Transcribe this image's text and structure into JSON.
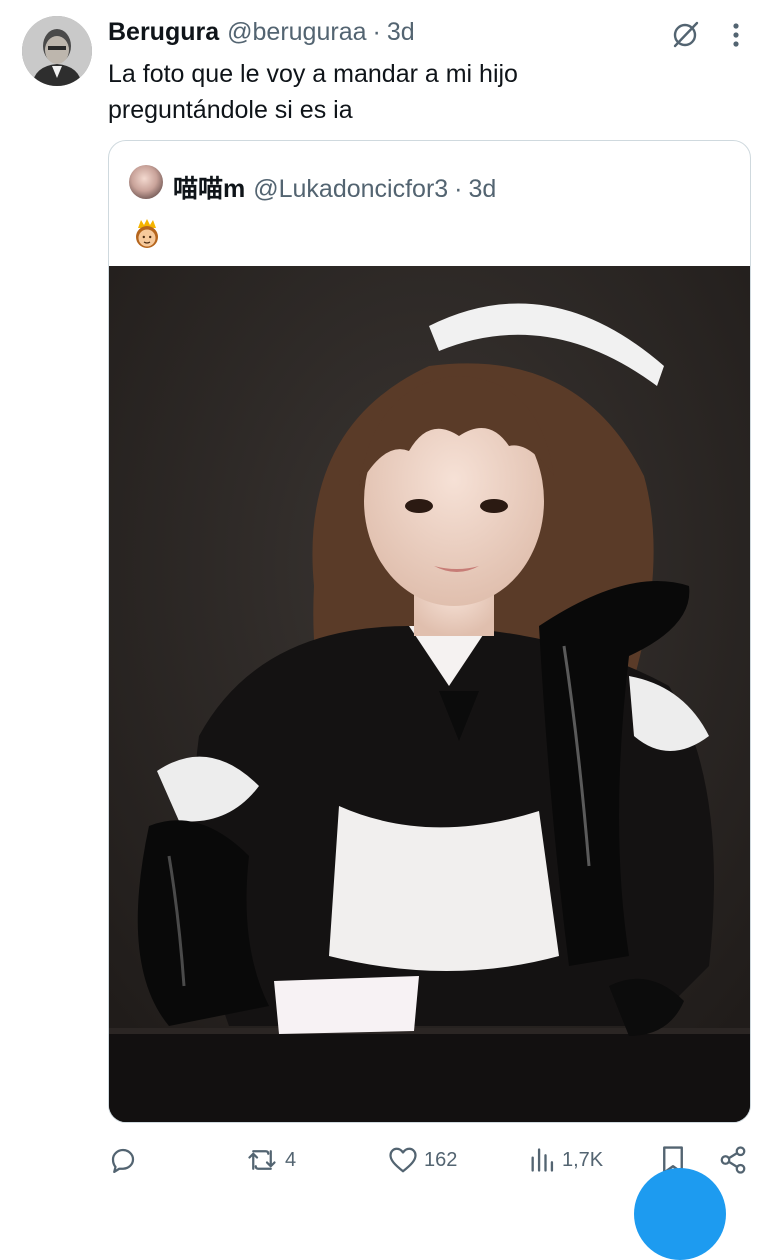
{
  "tweet": {
    "author_name": "Berugura",
    "author_handle": "@beruguraa",
    "separator": "·",
    "time": "3d",
    "text_line1": "La foto que le voy a mandar a mi hijo",
    "text_line2": "preguntándole si es ia",
    "icons": {
      "grok": "grok-icon",
      "more": "more-vertical-icon"
    }
  },
  "quote": {
    "author_name": "喵喵m",
    "author_handle": "@Lukadoncicfor3",
    "separator": "·",
    "time": "3d",
    "emoji": "princess-emoji",
    "media": "photo"
  },
  "actions": {
    "reply_icon": "reply-icon",
    "retweet_icon": "retweet-icon",
    "retweet_count": "4",
    "like_icon": "heart-icon",
    "like_count": "162",
    "views_icon": "views-icon",
    "views_count": "1,7K",
    "bookmark_icon": "bookmark-icon",
    "share_icon": "share-icon"
  },
  "colors": {
    "primary_text": "#0f1419",
    "secondary_text": "#536471",
    "border": "#cfd9de",
    "accent": "#1d9bf0"
  }
}
